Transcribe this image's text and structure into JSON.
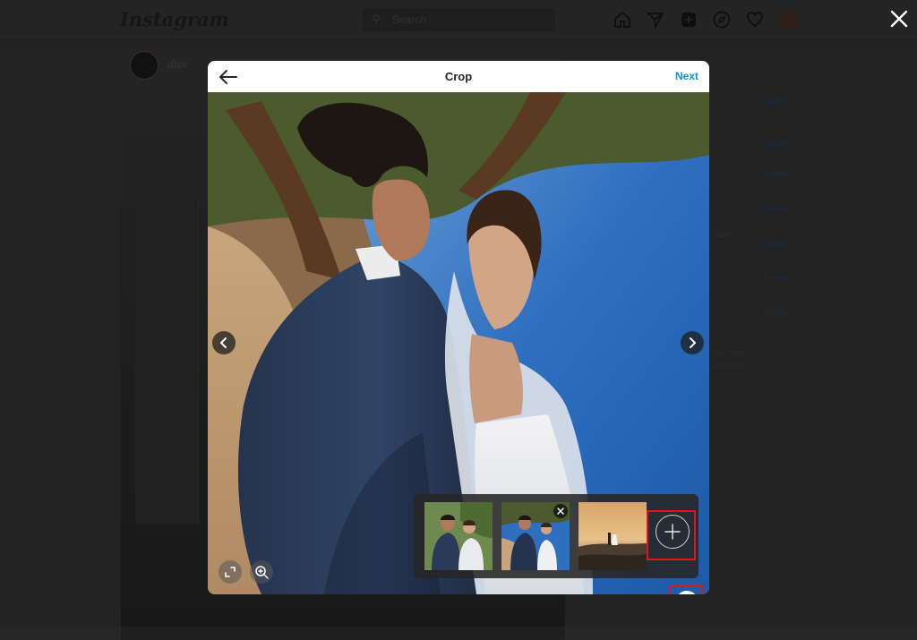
{
  "background": {
    "app_name": "Instagram",
    "search_placeholder": "Search",
    "post_username": "dior",
    "nav_icons": [
      "home-icon",
      "direct-icon",
      "new-post-icon",
      "explore-icon",
      "activity-icon",
      "profile-avatar"
    ],
    "sidebar_fragments": {
      "switch": "Switch",
      "see_all": "See All",
      "follow": "Follow",
      "suggestion_name_fragment": "nian",
      "footer_fragment_1": "ory · from",
      "footer_fragment_2": "anguage"
    }
  },
  "modal": {
    "title": "Crop",
    "next_label": "Next",
    "back_icon": "back-arrow-icon",
    "close_icon": "close-icon",
    "carousel": {
      "slide_count": 3,
      "active_index": 0
    },
    "gallery": {
      "thumbnails": [
        "couple-portrait-thumbnail",
        "couple-lakeside-thumbnail",
        "couple-sunset-cliff-thumbnail"
      ],
      "selected_index": 1,
      "add_icon": "plus-icon"
    },
    "tools": {
      "crop_icon": "crop-aspect-icon",
      "zoom_icon": "zoom-icon",
      "gallery_icon": "multiple-media-icon"
    },
    "colors": {
      "accent": "#0095f6",
      "highlight": "#e2131a"
    }
  }
}
